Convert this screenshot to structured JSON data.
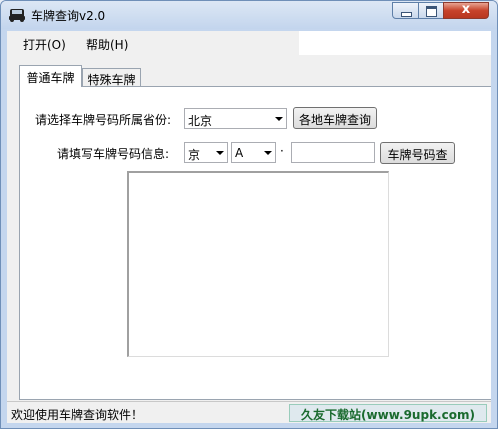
{
  "window": {
    "title": "车牌查询v2.0",
    "icon": "car-icon",
    "close_glyph": "x"
  },
  "menu": {
    "items": [
      {
        "label": "打开(O)"
      },
      {
        "label": "帮助(H)"
      }
    ]
  },
  "tabs": [
    {
      "label": "普通车牌",
      "active": true
    },
    {
      "label": "特殊车牌",
      "active": false
    }
  ],
  "form": {
    "province_label": "请选择车牌号码所属省份:",
    "province_value": "北京",
    "province_query_button": "各地车牌查询",
    "plate_label": "请填写车牌号码信息:",
    "plate_prefix_value": "京",
    "plate_letter_value": "A",
    "separator": "·",
    "plate_number_value": "",
    "plate_query_button": "车牌号码查"
  },
  "results": {
    "items": []
  },
  "status": {
    "text": "欢迎使用车牌查询软件！"
  },
  "watermark": {
    "text": "久友下载站(www.9upk.com)"
  },
  "colors": {
    "title_gradient_top": "#dce7f5",
    "title_gradient_bottom": "#c3d5ed",
    "close_button": "#c7432b",
    "watermark_text": "#1a6a2e"
  }
}
